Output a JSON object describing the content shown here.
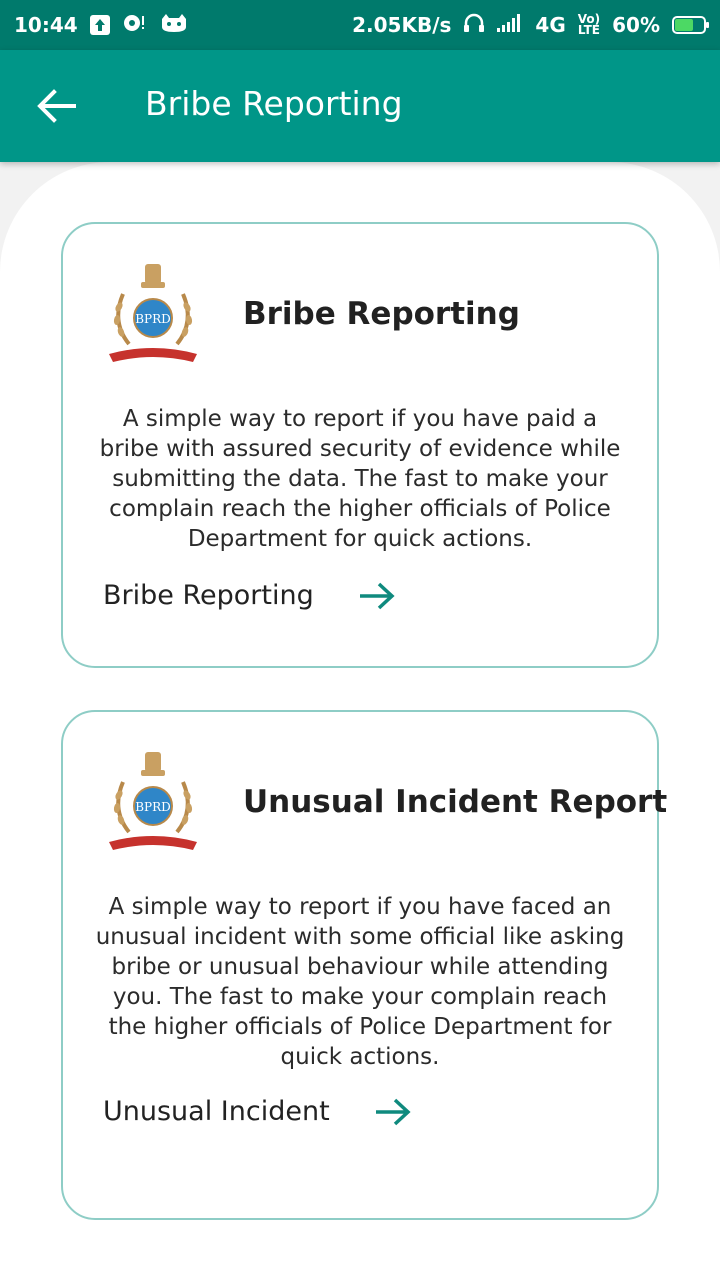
{
  "status_bar": {
    "time": "10:44",
    "speed": "2.05KB/s",
    "network": "4G",
    "volte_top": "Vo)",
    "volte_bottom": "LTE",
    "battery": "60%",
    "icons": [
      "upload-icon",
      "notification-icon",
      "cat-icon",
      "headphones-icon",
      "signal-icon",
      "battery-charging-icon"
    ]
  },
  "app_bar": {
    "title": "Bribe Reporting",
    "back_icon": "arrow-left-icon"
  },
  "cards": [
    {
      "title": "Bribe Reporting",
      "description": "A simple way to report if you have paid a bribe with assured security of evidence while submitting the data. The fast to make your complain reach the higher officials of Police Department for quick actions.",
      "link_label": "Bribe Reporting",
      "logo_text": "BPRD",
      "icon": "arrow-right-icon"
    },
    {
      "title": "Unusual Incident Report",
      "description": "A simple way to report if you have faced an unusual incident with some official like asking bribe or unusual behaviour while attending you. The fast to make your complain reach the higher officials of Police Department for quick actions.",
      "link_label": "Unusual Incident",
      "logo_text": "BPRD",
      "icon": "arrow-right-icon"
    }
  ],
  "colors": {
    "status_bar": "#007a6c",
    "app_bar": "#009688",
    "accent_arrow": "#0f8a7e",
    "card_border": "#8ecdc6"
  }
}
